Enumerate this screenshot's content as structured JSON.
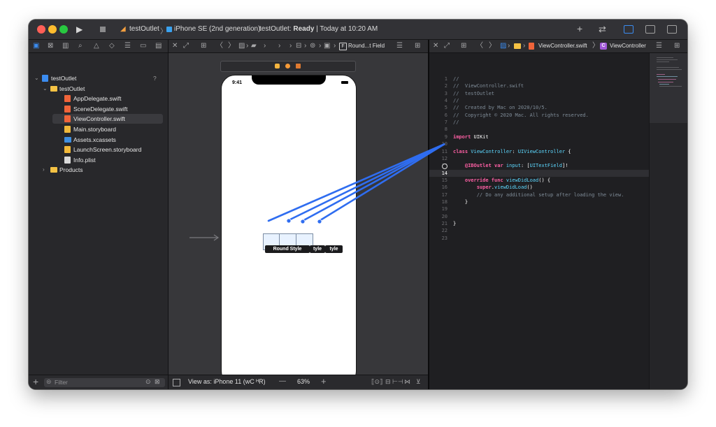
{
  "toolbar": {
    "project": "testOutlet",
    "device": "iPhone SE (2nd generation)",
    "status_prefix": "testOutlet: ",
    "status_state": "Ready",
    "status_sep": " | ",
    "status_time": "Today at 10:20 AM"
  },
  "navigator": {
    "items": [
      {
        "label": "testOutlet",
        "badge": "?",
        "kind": "project",
        "level": 0,
        "expanded": true
      },
      {
        "label": "testOutlet",
        "kind": "folder",
        "level": 1,
        "expanded": true
      },
      {
        "label": "AppDelegate.swift",
        "kind": "swift",
        "level": 2
      },
      {
        "label": "SceneDelegate.swift",
        "kind": "swift",
        "level": 2
      },
      {
        "label": "ViewController.swift",
        "kind": "swift",
        "level": 2,
        "selected": true
      },
      {
        "label": "Main.storyboard",
        "kind": "storyboard",
        "level": 2
      },
      {
        "label": "Assets.xcassets",
        "kind": "assets",
        "level": 2
      },
      {
        "label": "LaunchScreen.storyboard",
        "kind": "storyboard",
        "level": 2
      },
      {
        "label": "Info.plist",
        "kind": "plist",
        "level": 2
      },
      {
        "label": "Products",
        "kind": "folder",
        "level": 1,
        "expanded": false
      }
    ],
    "filter_placeholder": "Filter"
  },
  "canvas": {
    "crumb_last": "Round...t Field",
    "device_time": "9:41",
    "field_label_1": "Round Style",
    "field_label_2": "tyle",
    "field_label_3": "tyle",
    "view_as": "View as: iPhone 11 (ᴡC ᴴR)",
    "zoom": "63%",
    "zoom_minus": "—",
    "zoom_plus": "+"
  },
  "editor": {
    "crumb_file": "ViewController.swift",
    "crumb_class": "ViewController",
    "current_line": 14,
    "lines": [
      {
        "n": "1",
        "parts": [
          {
            "c": "c",
            "t": "//"
          }
        ]
      },
      {
        "n": "2",
        "parts": [
          {
            "c": "c",
            "t": "//  ViewController.swift"
          }
        ]
      },
      {
        "n": "3",
        "parts": [
          {
            "c": "c",
            "t": "//  testOutlet"
          }
        ]
      },
      {
        "n": "4",
        "parts": [
          {
            "c": "c",
            "t": "//"
          }
        ]
      },
      {
        "n": "5",
        "parts": [
          {
            "c": "c",
            "t": "//  Created by Mac on 2020/10/5."
          }
        ]
      },
      {
        "n": "6",
        "parts": [
          {
            "c": "c",
            "t": "//  Copyright © 2020 Mac. All rights reserved."
          }
        ]
      },
      {
        "n": "7",
        "parts": [
          {
            "c": "c",
            "t": "//"
          }
        ]
      },
      {
        "n": "8",
        "parts": []
      },
      {
        "n": "9",
        "parts": [
          {
            "c": "k",
            "t": "import"
          },
          {
            "c": "n",
            "t": " UIKit"
          }
        ]
      },
      {
        "n": "10",
        "parts": []
      },
      {
        "n": "11",
        "parts": [
          {
            "c": "k",
            "t": "class"
          },
          {
            "c": "n",
            "t": " "
          },
          {
            "c": "t",
            "t": "ViewController"
          },
          {
            "c": "n",
            "t": ": "
          },
          {
            "c": "t",
            "t": "UIViewController"
          },
          {
            "c": "n",
            "t": " {"
          }
        ]
      },
      {
        "n": "12",
        "parts": []
      },
      {
        "n": "13",
        "parts": [
          {
            "c": "n",
            "t": "    "
          },
          {
            "c": "k",
            "t": "@IBOutlet"
          },
          {
            "c": "n",
            "t": " "
          },
          {
            "c": "k",
            "t": "var"
          },
          {
            "c": "n",
            "t": " "
          },
          {
            "c": "t",
            "t": "input"
          },
          {
            "c": "n",
            "t": ": ["
          },
          {
            "c": "t",
            "t": "UITextField"
          },
          {
            "c": "n",
            "t": "]!"
          }
        ]
      },
      {
        "n": "14",
        "parts": []
      },
      {
        "n": "15",
        "parts": [
          {
            "c": "n",
            "t": "    "
          },
          {
            "c": "k",
            "t": "override"
          },
          {
            "c": "n",
            "t": " "
          },
          {
            "c": "k",
            "t": "func"
          },
          {
            "c": "n",
            "t": " "
          },
          {
            "c": "t",
            "t": "viewDidLoad"
          },
          {
            "c": "n",
            "t": "() {"
          }
        ]
      },
      {
        "n": "16",
        "parts": [
          {
            "c": "n",
            "t": "        "
          },
          {
            "c": "k",
            "t": "super"
          },
          {
            "c": "n",
            "t": "."
          },
          {
            "c": "t",
            "t": "viewDidLoad"
          },
          {
            "c": "n",
            "t": "()"
          }
        ]
      },
      {
        "n": "17",
        "parts": [
          {
            "c": "n",
            "t": "        "
          },
          {
            "c": "c",
            "t": "// Do any additional setup after loading the view."
          }
        ]
      },
      {
        "n": "18",
        "parts": [
          {
            "c": "n",
            "t": "    }"
          }
        ]
      },
      {
        "n": "19",
        "parts": []
      },
      {
        "n": "20",
        "parts": []
      },
      {
        "n": "21",
        "parts": [
          {
            "c": "n",
            "t": "}"
          }
        ]
      },
      {
        "n": "22",
        "parts": []
      },
      {
        "n": "23",
        "parts": []
      }
    ]
  },
  "colors": {
    "selection": "#3a3a3e",
    "connection": "#2f6df0",
    "folder": "#f5c244",
    "swift": "#f0643a",
    "assets": "#3f8fe0"
  }
}
